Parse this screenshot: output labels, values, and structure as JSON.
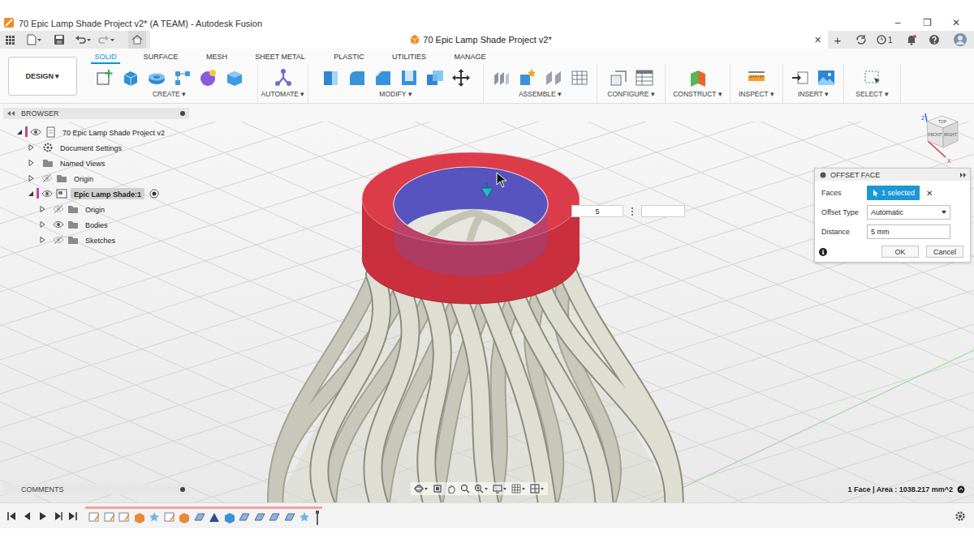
{
  "window": {
    "title": "70 Epic Lamp Shade Project v2* (A TEAM) - Autodesk Fusion",
    "controls": [
      "–",
      "❐",
      "✕"
    ]
  },
  "document_tab": {
    "label": "70 Epic Lamp Shade Project v2*",
    "close": "✕",
    "new_tab": "+"
  },
  "account": {
    "jobs_badge": "1"
  },
  "workspace": {
    "label": "DESIGN ▾"
  },
  "toolbar_tabs": [
    {
      "label": "SOLID",
      "selected": true
    },
    {
      "label": "SURFACE",
      "selected": false
    },
    {
      "label": "MESH",
      "selected": false
    },
    {
      "label": "SHEET METAL",
      "selected": false
    },
    {
      "label": "PLASTIC",
      "selected": false
    },
    {
      "label": "UTILITIES",
      "selected": false
    },
    {
      "label": "MANAGE",
      "selected": false
    }
  ],
  "tool_groups": [
    {
      "label": "CREATE ▾"
    },
    {
      "label": "AUTOMATE ▾"
    },
    {
      "label": "MODIFY ▾"
    },
    {
      "label": "ASSEMBLE ▾"
    },
    {
      "label": "CONFIGURE ▾"
    },
    {
      "label": "CONSTRUCT ▾"
    },
    {
      "label": "INSPECT ▾"
    },
    {
      "label": "INSERT ▾"
    },
    {
      "label": "SELECT ▾"
    }
  ],
  "browser": {
    "title": "BROWSER",
    "items": [
      {
        "label": "70 Epic Lamp Shade Project v2",
        "depth": 0,
        "kind": "document",
        "expanded": true,
        "visible": true,
        "active": false
      },
      {
        "label": "Document Settings",
        "depth": 1,
        "kind": "settings",
        "expanded": false,
        "active": false
      },
      {
        "label": "Named Views",
        "depth": 1,
        "kind": "folder",
        "expanded": false,
        "active": false
      },
      {
        "label": "Origin",
        "depth": 1,
        "kind": "folder",
        "expanded": false,
        "visible": false,
        "active": false
      },
      {
        "label": "Epic Lamp Shade:1",
        "depth": 1,
        "kind": "component",
        "expanded": true,
        "visible": true,
        "active": true
      },
      {
        "label": "Origin",
        "depth": 2,
        "kind": "folder",
        "expanded": false,
        "visible": false,
        "active": false
      },
      {
        "label": "Bodies",
        "depth": 2,
        "kind": "folder",
        "expanded": false,
        "visible": true,
        "active": false
      },
      {
        "label": "Sketches",
        "depth": 2,
        "kind": "folder",
        "expanded": false,
        "visible": false,
        "active": false
      }
    ]
  },
  "comments": {
    "title": "COMMENTS"
  },
  "dialog": {
    "title": "OFFSET FACE",
    "rows": [
      {
        "label": "Faces",
        "kind": "selection",
        "value": "1 selected",
        "clear": "✕"
      },
      {
        "label": "Offset Type",
        "kind": "dropdown",
        "value": "Automatic"
      },
      {
        "label": "Distance",
        "kind": "input",
        "value": "5 mm"
      }
    ],
    "info": "i",
    "buttons": [
      {
        "label": "OK"
      },
      {
        "label": "Cancel"
      }
    ]
  },
  "canvas_inputs": [
    {
      "value": "5"
    },
    {
      "value": ""
    }
  ],
  "viewcube": {
    "faces": [
      "TOP",
      "FRONT",
      "RIGHT"
    ],
    "axes": [
      "Z",
      "X"
    ]
  },
  "status": {
    "selection": "1 Face | Area : 1038.217 mm^2"
  },
  "timeline": {
    "features": [
      {
        "kind": "sketch"
      },
      {
        "kind": "sketch"
      },
      {
        "kind": "sketch"
      },
      {
        "kind": "extrude"
      },
      {
        "kind": "form"
      },
      {
        "kind": "sketch"
      },
      {
        "kind": "extrude"
      },
      {
        "kind": "surface"
      },
      {
        "kind": "sweep"
      },
      {
        "kind": "body"
      },
      {
        "kind": "surface"
      },
      {
        "kind": "surface"
      },
      {
        "kind": "surface"
      },
      {
        "kind": "surface"
      },
      {
        "kind": "form"
      }
    ]
  }
}
